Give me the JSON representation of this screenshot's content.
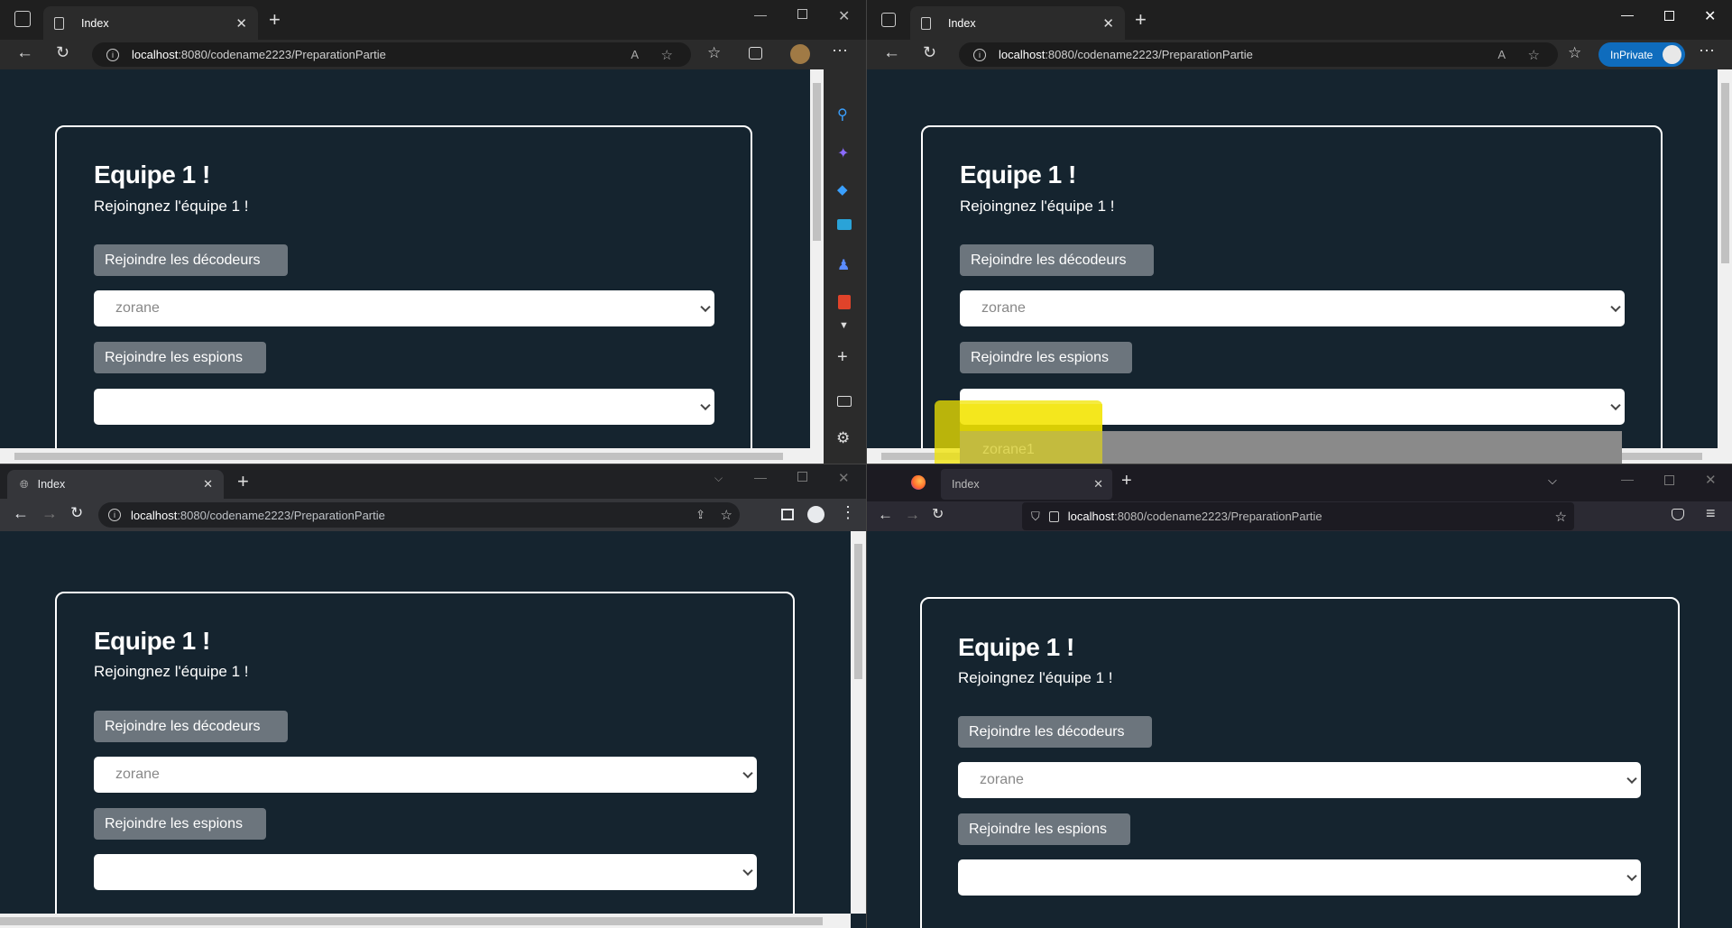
{
  "tab_title": "Index",
  "url": {
    "host": "localhost",
    "path": ":8080/codename2223/PreparationPartie"
  },
  "heading": "Equipe 1 !",
  "subheading": "Rejoingnez l'équipe 1 !",
  "btn_decodeurs": "Rejoindre les décodeurs",
  "btn_espions": "Rejoindre les espions",
  "select_decodeurs_value": "zorane",
  "select_espions_value": "",
  "dropdown_option": "zorane1",
  "inprivate_label": "InPrivate",
  "colors": {
    "page_bg": "#15242f",
    "button": "#6c757d",
    "highlight": "#f2e400",
    "inprivate": "#0f6cbd"
  }
}
